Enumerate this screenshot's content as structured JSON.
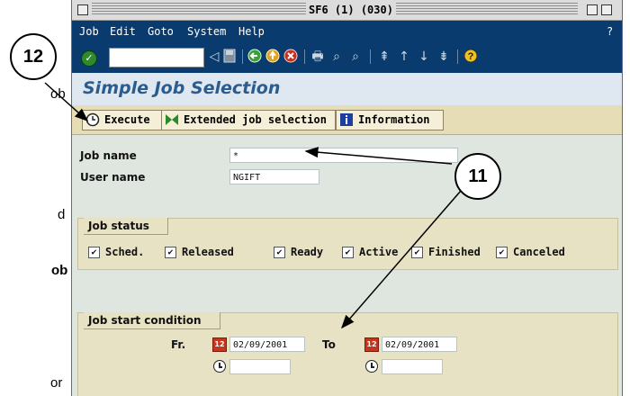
{
  "background_text": [
    {
      "text": "ob",
      "bold": false
    },
    {
      "text": "d",
      "bold": false
    },
    {
      "text": "ob",
      "bold": true
    },
    {
      "text": "or",
      "bold": false
    }
  ],
  "window": {
    "title": "SF6 (1) (030)"
  },
  "menu": {
    "items": [
      "Job",
      "Edit",
      "Goto",
      "System",
      "Help"
    ],
    "help_mark": "?"
  },
  "toolbar": {
    "icons": [
      "enter-icon",
      "back-icon",
      "save-icon",
      "back-nav-icon",
      "exit-icon",
      "cancel-icon",
      "print-icon",
      "find-icon",
      "find-next-icon",
      "first-page-icon",
      "previous-page-icon",
      "next-page-icon",
      "last-page-icon",
      "help-icon"
    ]
  },
  "screen": {
    "title": "Simple Job Selection"
  },
  "app_toolbar": {
    "execute": "Execute",
    "extended": "Extended job selection",
    "information": "Information"
  },
  "form": {
    "job_name_label": "Job name",
    "job_name_value": "*",
    "user_name_label": "User name",
    "user_name_value": "NGIFT"
  },
  "job_status": {
    "title": "Job status",
    "options": [
      {
        "label": "Sched.",
        "checked": true
      },
      {
        "label": "Released",
        "checked": true
      },
      {
        "label": "Ready",
        "checked": true
      },
      {
        "label": "Active",
        "checked": true
      },
      {
        "label": "Finished",
        "checked": true
      },
      {
        "label": "Canceled",
        "checked": true
      }
    ],
    "check_mark": "✔"
  },
  "start_condition": {
    "title": "Job start condition",
    "from_label": "Fr.",
    "from_date": "02/09/2001",
    "to_label": "To",
    "to_date": "02/09/2001",
    "calendar_icon_text": "12"
  },
  "callouts": {
    "left": "12",
    "right": "11"
  },
  "colors": {
    "menubar": "#0a3b6e",
    "title_text": "#2b5c8f",
    "app_toolbar": "#e6ddb6",
    "group": "#e8e2c4"
  }
}
